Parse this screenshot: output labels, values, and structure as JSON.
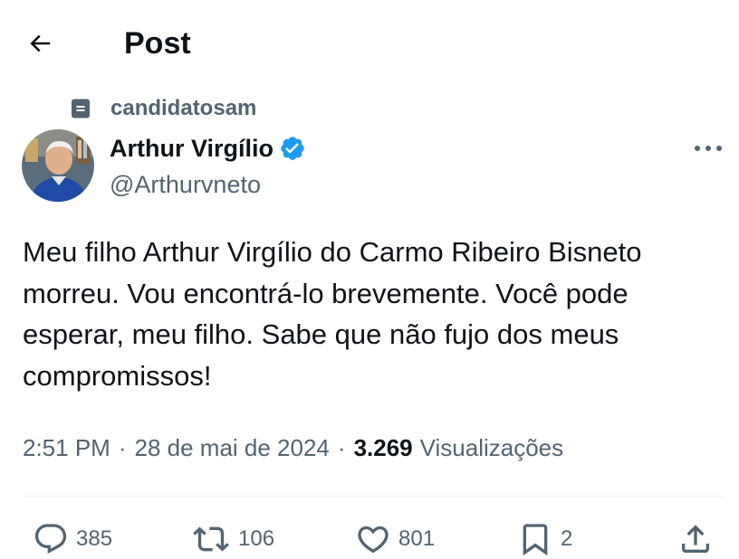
{
  "header": {
    "title": "Post"
  },
  "social_context": {
    "label": "candidatosam"
  },
  "author": {
    "name": "Arthur Virgílio",
    "handle": "@Arthurvneto",
    "verified": true
  },
  "tweet": {
    "text": "Meu filho Arthur Virgílio do Carmo Ribeiro Bisneto morreu. Vou encontrá-lo brevemente. Você pode esperar, meu filho. Sabe que não fujo dos meus compromissos!"
  },
  "meta": {
    "time": "2:51 PM",
    "separator": "·",
    "date": "28 de mai de 2024",
    "views_count": "3.269",
    "views_label": "Visualizações"
  },
  "actions": {
    "replies": "385",
    "reposts": "106",
    "likes": "801",
    "bookmarks": "2"
  },
  "icons": {
    "back": "arrow-left-icon",
    "list": "list-icon",
    "verified": "verified-badge-icon",
    "more": "more-horizontal-icon",
    "reply": "reply-bubble-icon",
    "repost": "repost-icon",
    "like": "heart-icon",
    "bookmark": "bookmark-icon",
    "share": "share-icon"
  },
  "colors": {
    "text_primary": "#0f1419",
    "text_secondary": "#536471",
    "verified_blue": "#1d9bf0",
    "divider": "#eff3f4"
  }
}
